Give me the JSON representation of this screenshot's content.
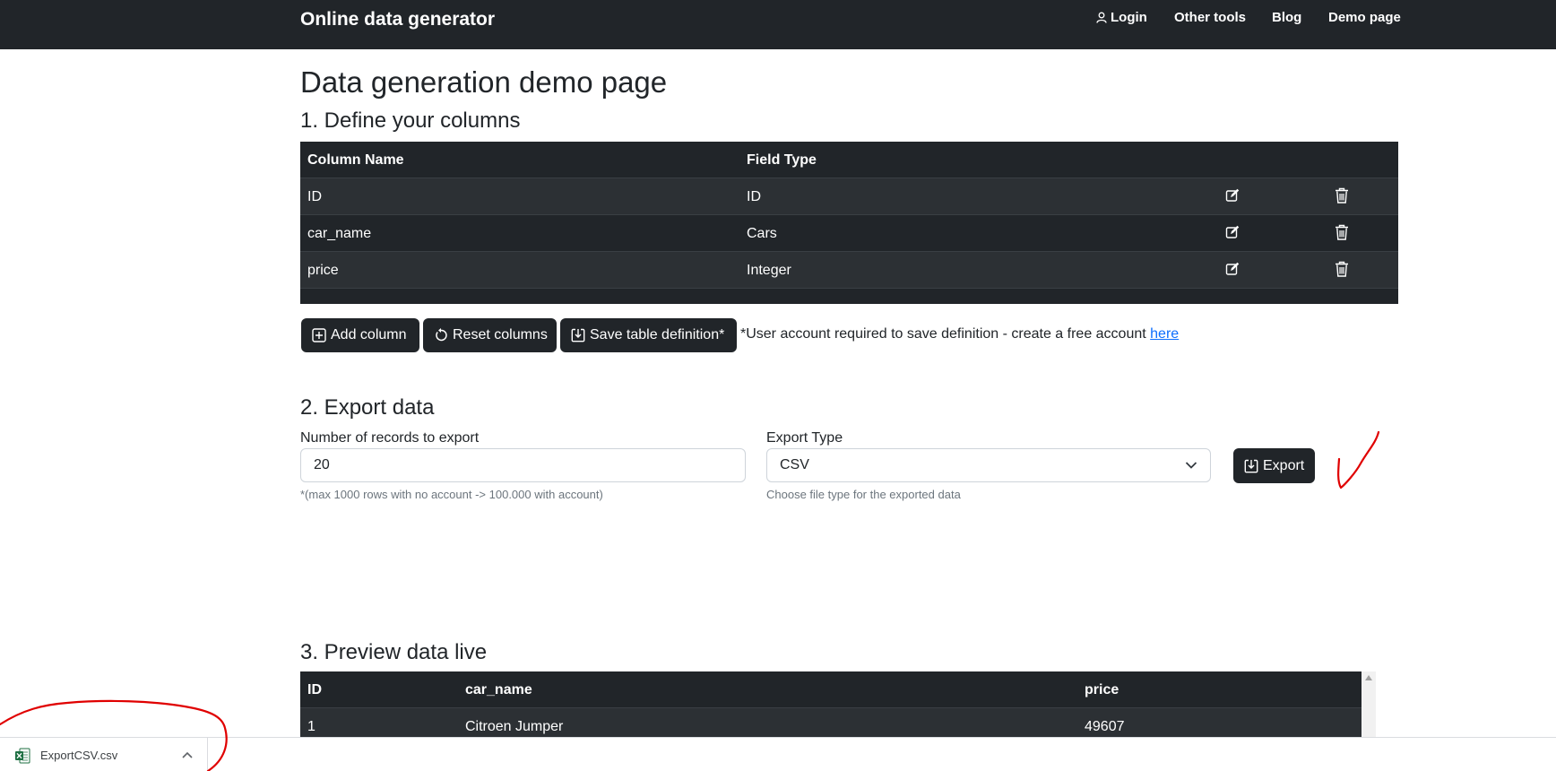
{
  "navbar": {
    "brand": "Online data generator",
    "login": "Login",
    "other_tools": "Other tools",
    "blog": "Blog",
    "demo_page": "Demo page"
  },
  "page_title": "Data generation demo page",
  "define_section": {
    "heading": "1. Define your columns",
    "headers": {
      "column_name": "Column Name",
      "field_type": "Field Type"
    },
    "rows": [
      {
        "name": "ID",
        "type": "ID"
      },
      {
        "name": "car_name",
        "type": "Cars"
      },
      {
        "name": "price",
        "type": "Integer"
      }
    ],
    "add_column": "Add column",
    "reset_columns": "Reset columns",
    "save_definition": "Save table definition*",
    "save_note": "*User account required to save definition - create a free account",
    "save_note_link": "here"
  },
  "export_section": {
    "heading": "2. Export data",
    "records_label": "Number of records to export",
    "records_value": "20",
    "records_help": "*(max 1000 rows with no account -> 100.000 with account)",
    "type_label": "Export Type",
    "type_value": "CSV",
    "type_help": "Choose file type for the exported data",
    "export_button": "Export"
  },
  "preview_section": {
    "heading": "3. Preview data live",
    "headers": [
      "ID",
      "car_name",
      "price"
    ],
    "rows": [
      {
        "id": "1",
        "car_name": "Citroen Jumper",
        "price": "49607"
      }
    ]
  },
  "download_bar": {
    "file_name": "ExportCSV.csv",
    "file_icon": "excel-file-icon"
  },
  "colors": {
    "dark": "#212529",
    "striped": "#2c3034",
    "link": "#0d6efd",
    "annotation": "#e00000"
  }
}
